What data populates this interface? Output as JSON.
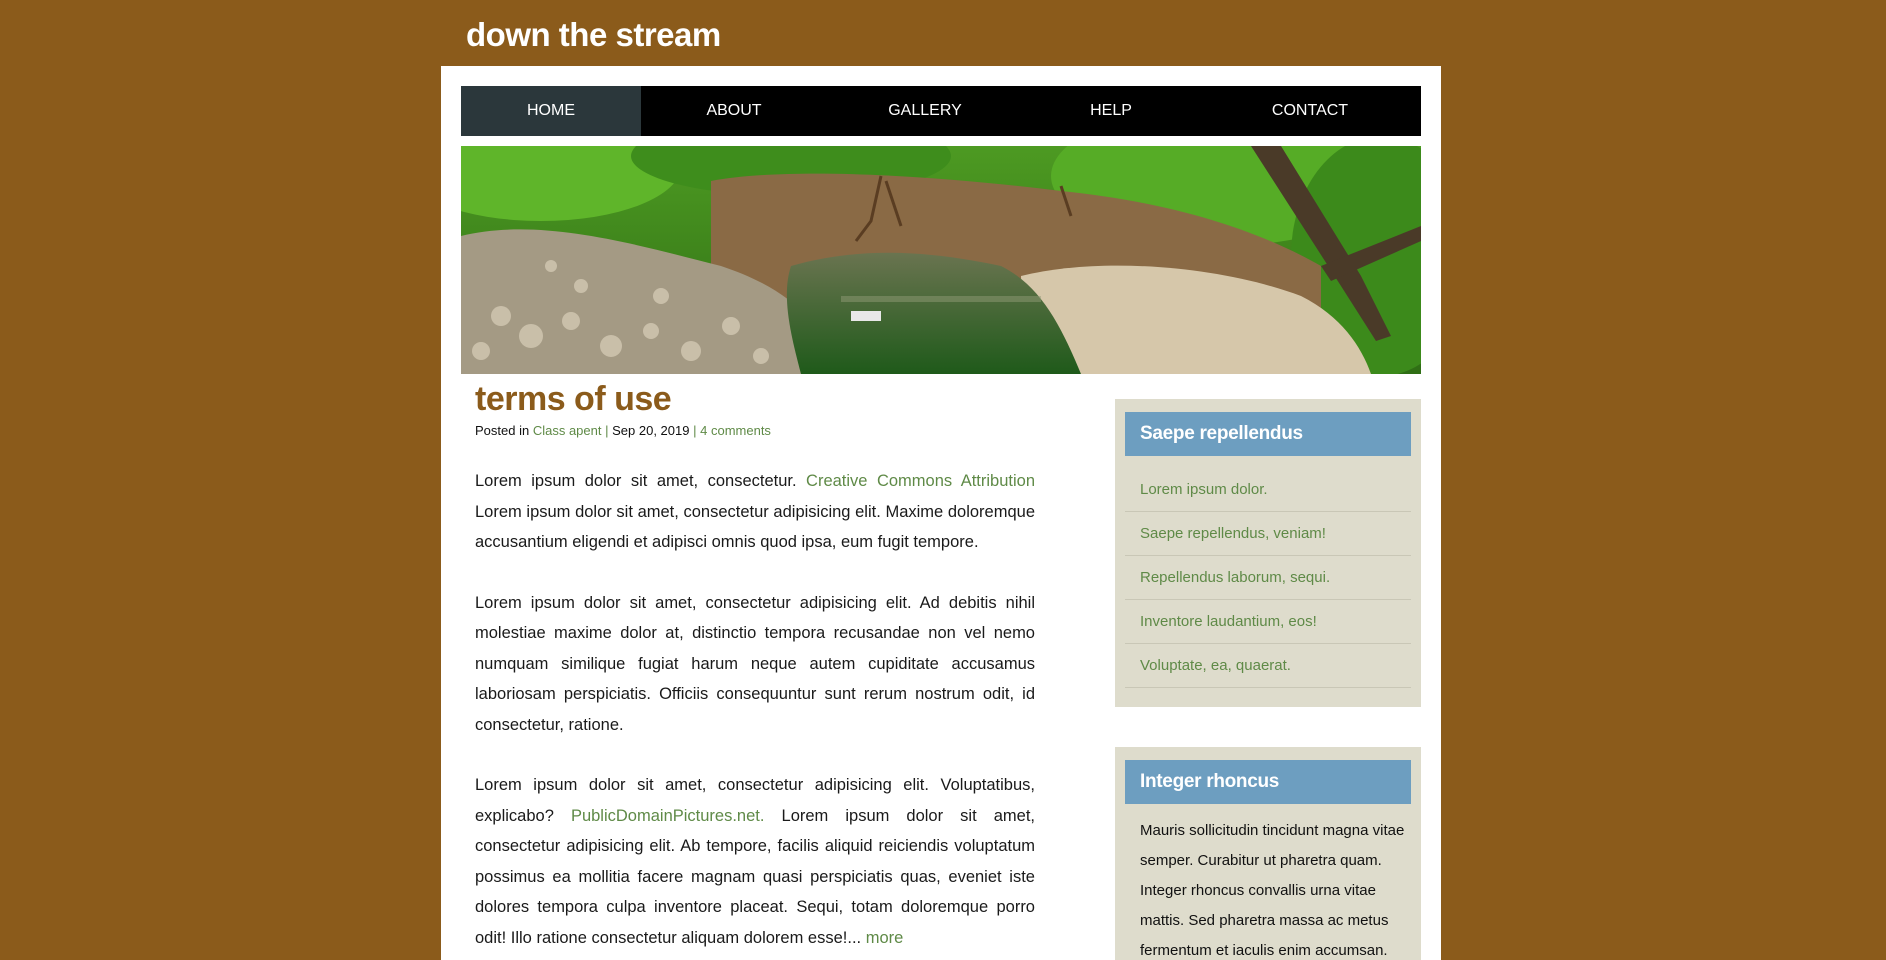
{
  "site": {
    "title": "down the stream"
  },
  "nav": {
    "items": [
      {
        "label": "HOME",
        "active": true
      },
      {
        "label": "ABOUT"
      },
      {
        "label": "GALLERY"
      },
      {
        "label": "HELP"
      },
      {
        "label": "CONTACT"
      }
    ]
  },
  "hero": {
    "image": "forest-stream-photo"
  },
  "post": {
    "title": "terms of use",
    "meta": {
      "prefix": "Posted in",
      "category": "Class apent",
      "sep1": "|",
      "date": "Sep 20, 2019",
      "sep2": "|",
      "comments": "4 comments"
    },
    "p1": {
      "text_before": "Lorem ipsum dolor sit amet, consectetur. ",
      "link": "Creative Commons Attribution",
      "text_after": " Lorem ipsum dolor sit amet, consectetur adipisicing elit. Maxime doloremque accusantium eligendi et adipisci omnis quod ipsa, eum fugit tempore."
    },
    "p2": {
      "text": "Lorem ipsum dolor sit amet, consectetur adipisicing elit. Ad debitis nihil molestiae maxime dolor at, distinctio tempora recusandae non vel nemo numquam similique fugiat harum neque autem cupiditate accusamus laboriosam perspiciatis. Officiis consequuntur sunt rerum nostrum odit, id consectetur, ratione."
    },
    "p3": {
      "text_before": "Lorem ipsum dolor sit amet, consectetur adipisicing elit. Voluptatibus, explicabo? ",
      "link": "PublicDomainPictures.net.",
      "text_after": " Lorem ipsum dolor sit amet, consectetur adipisicing elit. Ab tempore, facilis aliquid reiciendis voluptatum possimus ea mollitia facere magnam quasi perspiciatis quas, eveniet iste dolores tempora culpa inventore placeat. Sequi, totam doloremque porro odit! Illo ratione consectetur aliquam dolorem esse!... ",
      "more": "more"
    }
  },
  "sidebar": {
    "widget1": {
      "title": "Saepe repellendus",
      "items": [
        "Lorem ipsum dolor.",
        "Saepe repellendus, veniam!",
        "Repellendus laborum, sequi.",
        "Inventore laudantium, eos!",
        "Voluptate, ea, quaerat."
      ]
    },
    "widget2": {
      "title": "Integer rhoncus",
      "text": "Mauris sollicitudin tincidunt magna vitae semper. Curabitur ut pharetra quam. Integer rhoncus convallis urna vitae mattis. Sed pharetra massa ac metus fermentum et iaculis enim accumsan."
    }
  },
  "colors": {
    "background": "#8b5b1b",
    "nav_active": "#2b373b",
    "link": "#5f8a47",
    "widget_bg": "#dedccc",
    "widget_head": "#6d9ec0"
  }
}
